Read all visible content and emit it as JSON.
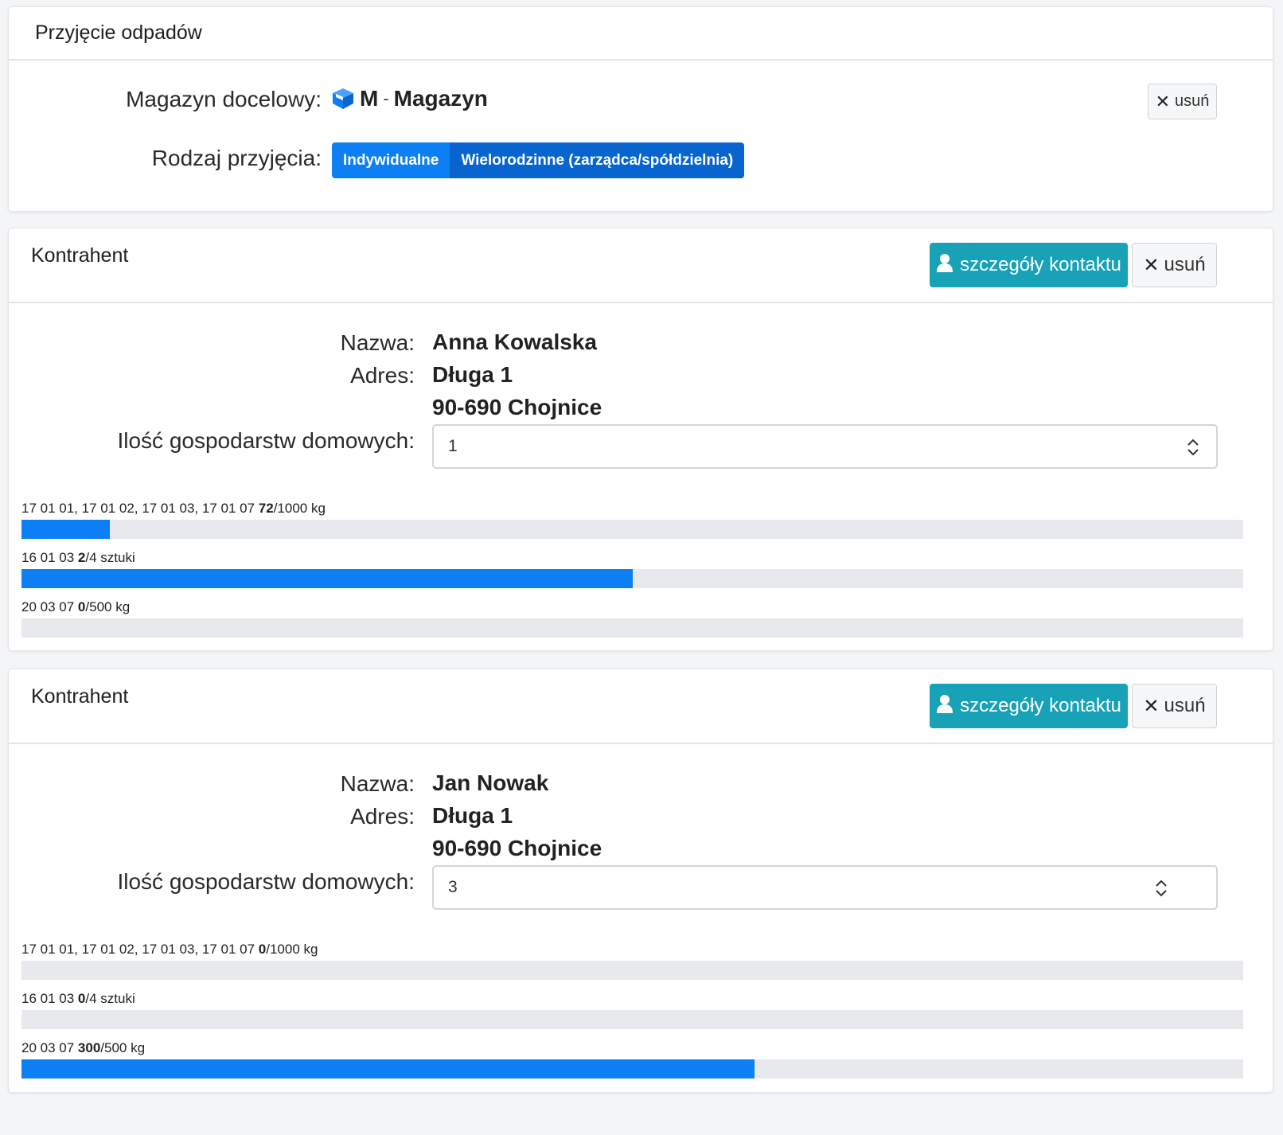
{
  "colors": {
    "primary": "#0d7ff5",
    "info": "#17a2b8",
    "track": "#e8e9ec"
  },
  "receipt": {
    "title": "Przyjęcie odpadów",
    "warehouse_label": "Magazyn docelowy:",
    "warehouse_icon": "box-icon",
    "warehouse_code": "M",
    "warehouse_sep": "-",
    "warehouse_name": "Magazyn",
    "remove_label": "usuń",
    "type_label": "Rodzaj przyjęcia:",
    "type_options": [
      "Indywidualne",
      "Wielorodzinne (zarządca/spółdzielnia)"
    ]
  },
  "contractors": [
    {
      "title": "Kontrahent",
      "contact_button": "szczegóły kontaktu",
      "remove_button": "usuń",
      "name_label": "Nazwa:",
      "name": "Anna Kowalska",
      "address_label": "Adres:",
      "address_line1": "Długa 1",
      "address_line2": "90-690 Chojnice",
      "households_label": "Ilość gospodarstw domowych:",
      "households": "1",
      "limits": [
        {
          "codes": "17 01 01, 17 01 02, 17 01 03, 17 01 07",
          "used": "72",
          "rest": "/1000 kg",
          "fraction": 0.072
        },
        {
          "codes": "16 01 03",
          "used": "2",
          "rest": "/4 sztuki",
          "fraction": 0.5
        },
        {
          "codes": "20 03 07",
          "used": "0",
          "rest": "/500 kg",
          "fraction": 0
        }
      ]
    },
    {
      "title": "Kontrahent",
      "contact_button": "szczegóły kontaktu",
      "remove_button": "usuń",
      "name_label": "Nazwa:",
      "name": "Jan Nowak",
      "address_label": "Adres:",
      "address_line1": "Długa 1",
      "address_line2": "90-690 Chojnice",
      "households_label": "Ilość gospodarstw domowych:",
      "households": "3",
      "limits": [
        {
          "codes": "17 01 01, 17 01 02, 17 01 03, 17 01 07",
          "used": "0",
          "rest": "/1000 kg",
          "fraction": 0
        },
        {
          "codes": "16 01 03",
          "used": "0",
          "rest": "/4 sztuki",
          "fraction": 0
        },
        {
          "codes": "20 03 07",
          "used": "300",
          "rest": "/500 kg",
          "fraction": 0.6
        }
      ]
    }
  ]
}
